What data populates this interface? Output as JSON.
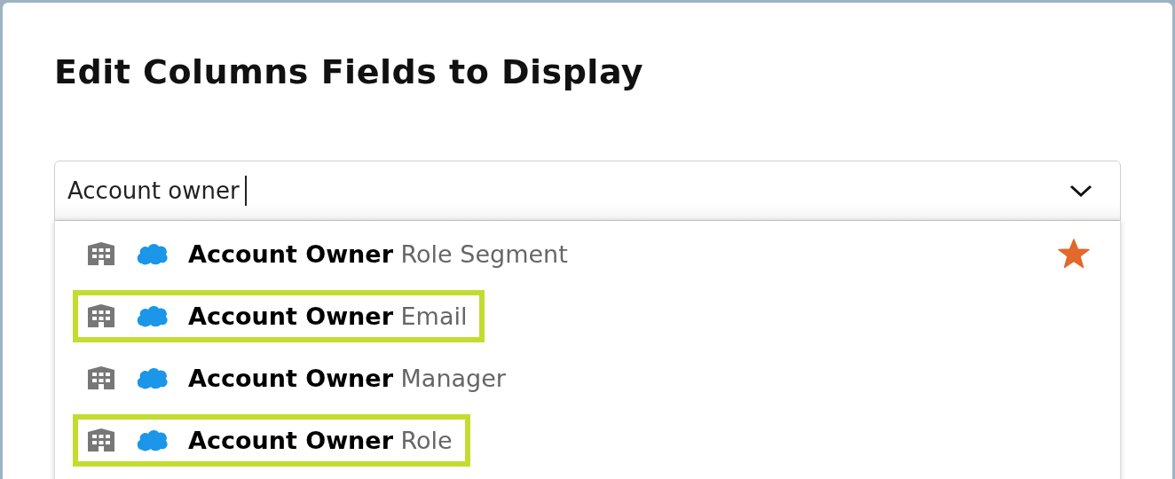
{
  "dialog": {
    "title": "Edit Columns Fields to Display"
  },
  "field": {
    "value": "Account owner"
  },
  "options": [
    {
      "label": "**Account Owner** Role Segment",
      "favorite": true,
      "highlighted": false
    },
    {
      "label": "**Account Owner** Email",
      "favorite": false,
      "highlighted": true
    },
    {
      "label": "**Account Owner** Manager",
      "favorite": false,
      "highlighted": false
    },
    {
      "label": "**Account Owner** Role",
      "favorite": false,
      "highlighted": true
    }
  ]
}
